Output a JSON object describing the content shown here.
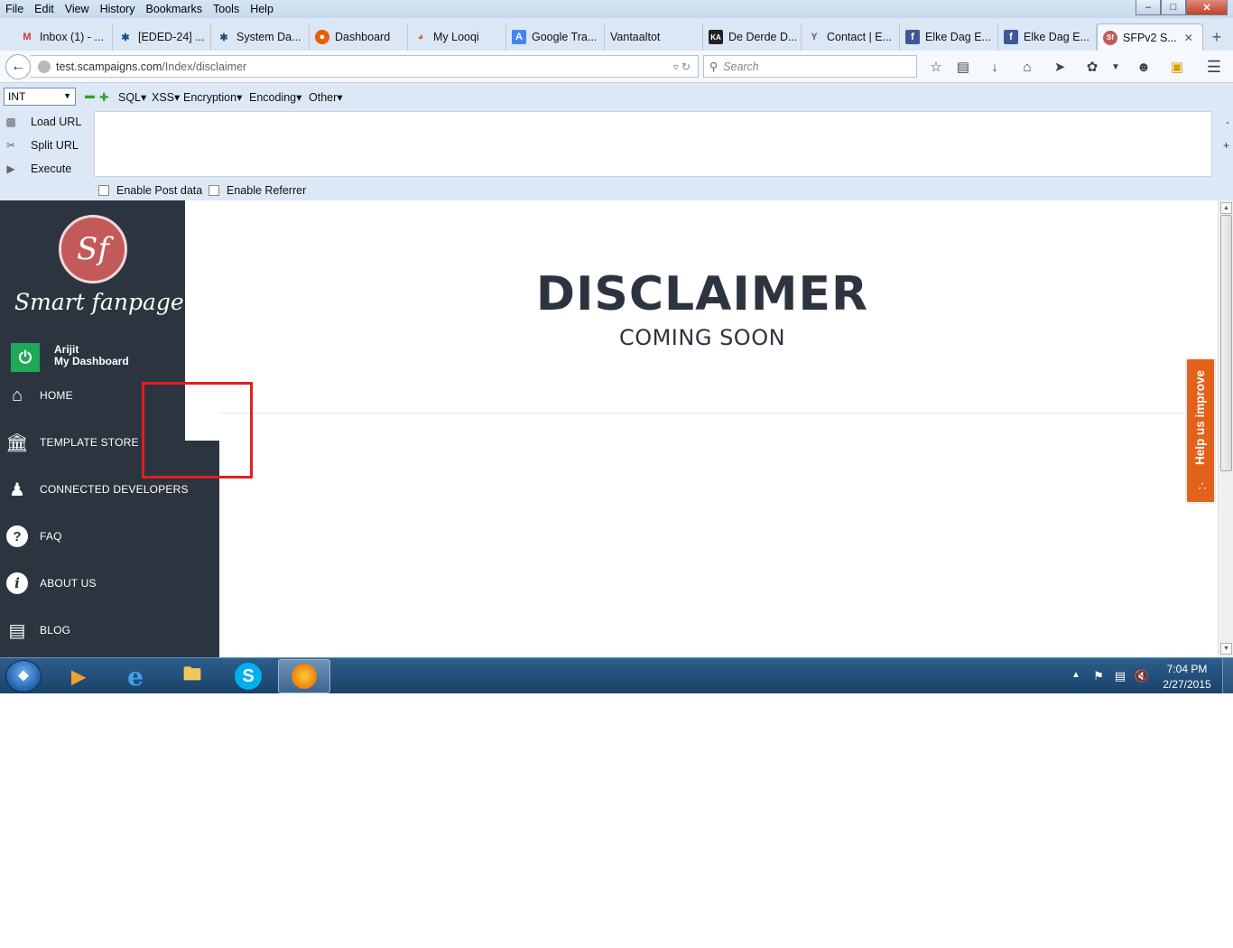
{
  "menubar": {
    "items": [
      "File",
      "Edit",
      "View",
      "History",
      "Bookmarks",
      "Tools",
      "Help"
    ]
  },
  "tabs": [
    {
      "label": "Inbox (1) - ...",
      "icon": "gmail-icon",
      "color": "#d93025"
    },
    {
      "label": "[EDED-24] ...",
      "icon": "jira-icon",
      "color": "#205081"
    },
    {
      "label": "System Da...",
      "icon": "jira-icon",
      "color": "#205081"
    },
    {
      "label": "Dashboard",
      "icon": "firefox-icon",
      "color": "#e66000"
    },
    {
      "label": "My Looqi",
      "icon": "looqi-icon",
      "color": "#e05a2a"
    },
    {
      "label": "Google Tra...",
      "icon": "google-translate-icon",
      "color": "#4285f4"
    },
    {
      "label": "Vantaaltot",
      "icon": "",
      "color": ""
    },
    {
      "label": "De Derde D...",
      "icon": "ka-icon",
      "color": "#222222"
    },
    {
      "label": "Contact | E...",
      "icon": "yammer-icon",
      "color": "#7b4f9d"
    },
    {
      "label": "Elke Dag E...",
      "icon": "facebook-icon",
      "color": "#3b5998"
    },
    {
      "label": "Elke Dag E...",
      "icon": "facebook-icon",
      "color": "#3b5998"
    },
    {
      "label": "SFPv2 S...",
      "icon": "sf-icon",
      "color": "#c35a5a",
      "active": true
    }
  ],
  "navbar": {
    "url_host": "test.scampaigns.com",
    "url_path": "/Index/disclaimer",
    "search_placeholder": "Search"
  },
  "hackbar": {
    "select_value": "INT",
    "menus": [
      "SQL",
      "XSS",
      "Encryption",
      "Encoding",
      "Other"
    ],
    "actions": [
      "Load URL",
      "Split URL",
      "Execute"
    ],
    "checkboxes": [
      "Enable Post data",
      "Enable Referrer"
    ]
  },
  "sidebar": {
    "logo_text": "Smart fanpage",
    "user_name": "Arijit",
    "user_link": "My Dashboard",
    "items": [
      {
        "label": "HOME",
        "icon": "home-icon"
      },
      {
        "label": "TEMPLATE STORE",
        "icon": "bank-icon"
      },
      {
        "label": "CONNECTED DEVELOPERS",
        "icon": "users-icon"
      },
      {
        "label": "FAQ",
        "icon": "question-icon"
      },
      {
        "label": "ABOUT US",
        "icon": "info-icon"
      },
      {
        "label": "BLOG",
        "icon": "newspaper-icon"
      }
    ]
  },
  "main": {
    "title": "DISCLAIMER",
    "subtitle": "COMING SOON"
  },
  "feedback": {
    "label": "Help us improve"
  },
  "taskbar": {
    "time": "7:04 PM",
    "date": "2/27/2015"
  },
  "colors": {
    "sidebar_bg": "#2c3440",
    "accent_green": "#1faa5a",
    "feedback_orange": "#e2621b",
    "annotation_red": "#e02020"
  }
}
